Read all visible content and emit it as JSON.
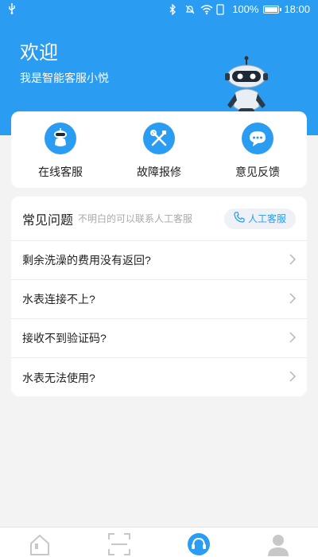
{
  "status_bar": {
    "battery": "100%",
    "time": "18:00"
  },
  "header": {
    "title": "欢迎",
    "subtitle": "我是智能客服小悦"
  },
  "quick_actions": [
    {
      "label": "在线客服",
      "icon": "robot-icon"
    },
    {
      "label": "故障报修",
      "icon": "wrench-screwdriver-icon"
    },
    {
      "label": "意见反馈",
      "icon": "chat-bubble-icon"
    }
  ],
  "faq": {
    "title": "常见问题",
    "hint": "不明白的可以联系人工客服",
    "contact_label": "人工客服",
    "items": [
      "剩余洗澡的费用没有返回?",
      "水表连接不上?",
      "接收不到验证码?",
      "水表无法使用?"
    ]
  },
  "tabbar": {
    "tabs": [
      "home-icon",
      "scan-icon",
      "service-icon",
      "profile-icon"
    ],
    "active_index": 2
  },
  "colors": {
    "primary": "#2a9cf2",
    "background": "#f3f3f3"
  }
}
